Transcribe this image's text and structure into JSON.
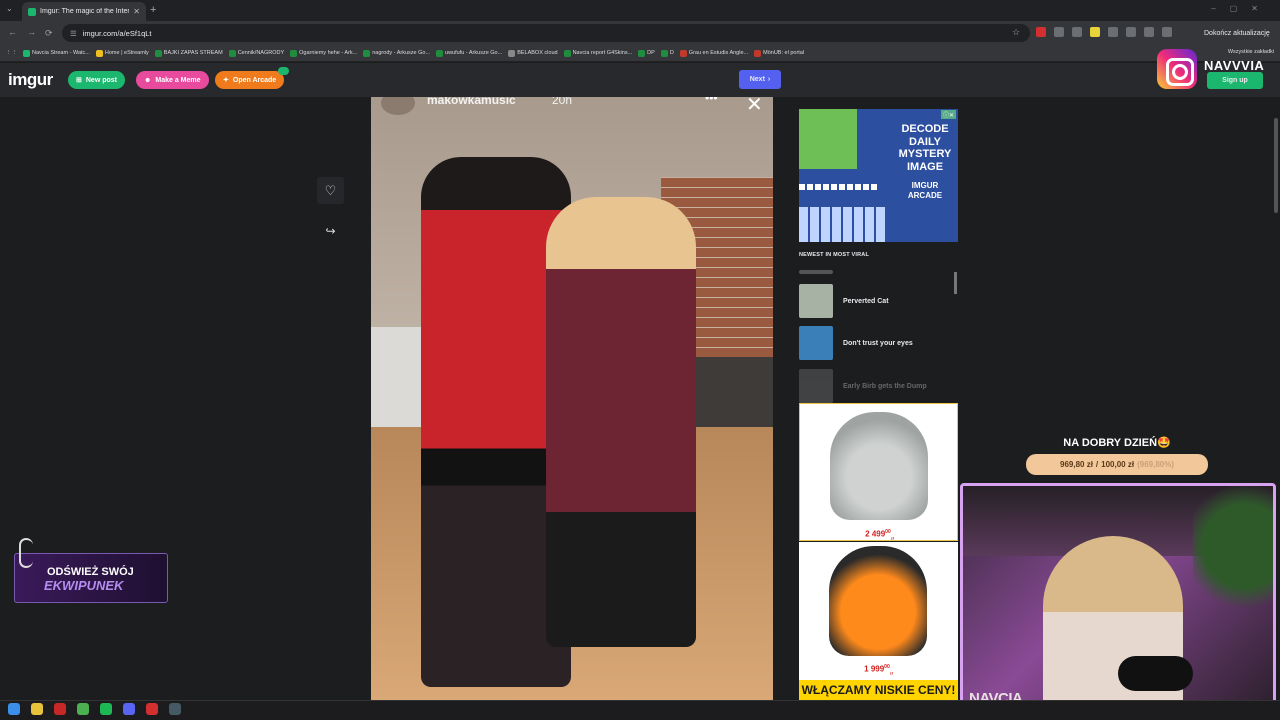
{
  "browser": {
    "tab_title": "Imgur: The magic of the Internet",
    "url": "imgur.com/a/eSf1qLt",
    "update_label": "Dokończ aktualizację",
    "all_bookmarks": "Wszystkie zakładki",
    "bookmarks": [
      {
        "label": "Navcia Stream - Watc...",
        "color": "#1bb76e"
      },
      {
        "label": "Home | eStreamly",
        "color": "#f0c020"
      },
      {
        "label": "BAJKI ZAPAS STREAM",
        "color": "#1e8e3e"
      },
      {
        "label": "Cennik/NAGRODY",
        "color": "#1e8e3e"
      },
      {
        "label": "Ogarniemy hehe - Ark...",
        "color": "#1e8e3e"
      },
      {
        "label": "nagrody - Arkusze Go...",
        "color": "#1e8e3e"
      },
      {
        "label": "uwufufu - Arkusze Go...",
        "color": "#1e8e3e"
      },
      {
        "label": "BELABOX cloud",
        "color": "#888888"
      },
      {
        "label": "Navcia report G4Skins...",
        "color": "#1e8e3e"
      },
      {
        "label": "DP",
        "color": "#1e8e3e"
      },
      {
        "label": "D",
        "color": "#1e8e3e"
      },
      {
        "label": "Grau en Estudis Angle...",
        "color": "#c0392b"
      },
      {
        "label": "MönUB: el portal",
        "color": "#c0392b"
      }
    ]
  },
  "imgur": {
    "logo": "imgur",
    "new_post": "New post",
    "make_meme": "Make a Meme",
    "open_arcade": "Open Arcade",
    "next": "Next",
    "sign_up": "Sign up"
  },
  "post": {
    "username": "makowkamusic",
    "time": "20h"
  },
  "ad": {
    "headline": "DECODE DAILY MYSTERY IMAGE",
    "sub": "IMGUR ARCADE"
  },
  "viral": {
    "heading": "NEWEST IN MOST VIRAL",
    "items": [
      {
        "title": "Perverted Cat"
      },
      {
        "title": "Don't trust your eyes"
      },
      {
        "title": "Early Birb gets the Dump"
      }
    ]
  },
  "products": [
    {
      "price": "2 499",
      "cents": "00",
      "currency": "zł"
    },
    {
      "price": "1 999",
      "cents": "00",
      "currency": "zł"
    }
  ],
  "banner": "WŁĄCZAMY NISKIE CENY!",
  "overlay": {
    "instagram": "NAVVVIA",
    "greeting": "NA DOBRY DZIEŃ🤩",
    "goal_current": "969,80 zł",
    "goal_target": "100,00 zł",
    "goal_percent": "(969,80%)",
    "cam_name": "NAVCIA",
    "promo_line1": "ODŚWIEŻ SWÓJ",
    "promo_line2": "EKWIPUNEK"
  },
  "colors": {
    "imgur_green": "#1bb76e",
    "next_blue": "#5461f0",
    "meme_pink": "#e84a9d",
    "arcade_orange": "#ef7b1c"
  }
}
